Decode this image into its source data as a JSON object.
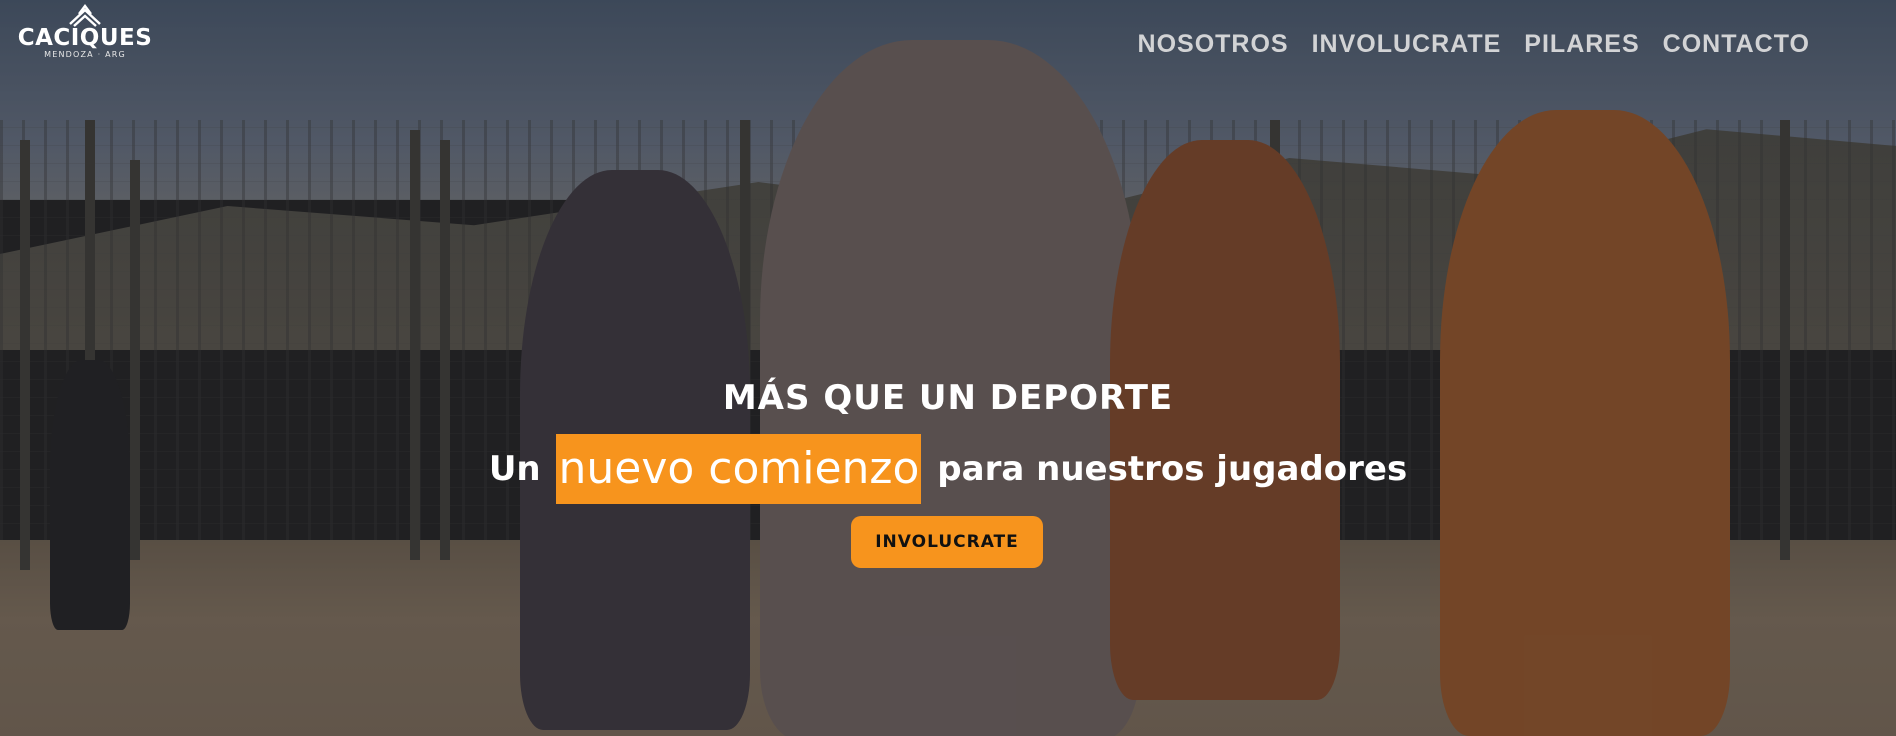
{
  "brand": {
    "name": "CACIQUES",
    "tagline": "MENDOZA · ARG",
    "logo_icon": "mountain-peaks-icon"
  },
  "nav": {
    "items": [
      {
        "label": "NOSOTROS"
      },
      {
        "label": "INVOLUCRATE"
      },
      {
        "label": "PILARES"
      },
      {
        "label": "CONTACTO"
      }
    ]
  },
  "hero": {
    "title": "MÁS QUE UN DEPORTE",
    "subtitle_before": "Un",
    "subtitle_highlight": "nuevo comienzo",
    "subtitle_after": "para nuestros jugadores",
    "cta_label": "INVOLUCRATE"
  },
  "colors": {
    "accent": "#f7941d",
    "text": "#ffffff",
    "nav_text": "#e6e6e6"
  }
}
